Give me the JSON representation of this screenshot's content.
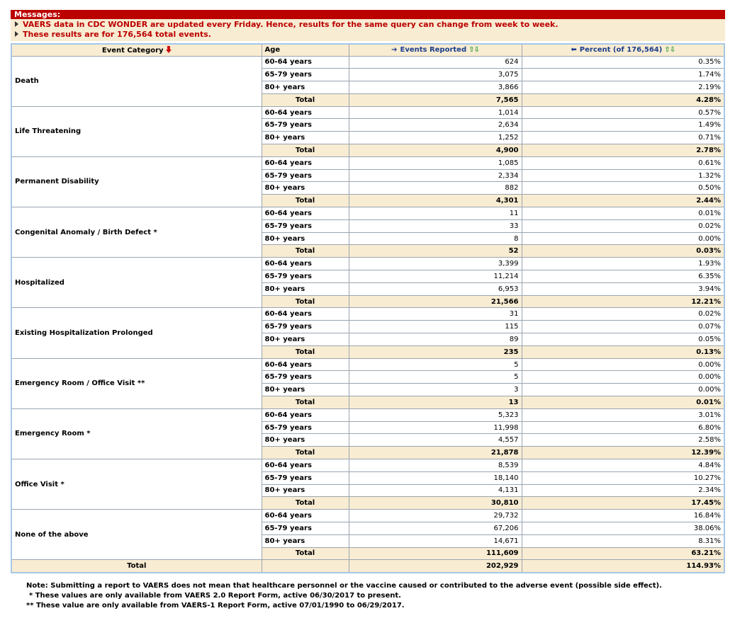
{
  "messages": {
    "header": "Messages:",
    "lines": [
      "VAERS data in CDC WONDER are updated every Friday. Hence, results for the same query can change from week to week.",
      "These results are for 176,564 total events."
    ]
  },
  "table": {
    "headers": {
      "event_category": "Event Category",
      "age": "Age",
      "events_reported": "Events Reported",
      "percent": "Percent (of 176,564)"
    },
    "total_label": "Total",
    "categories": [
      {
        "name": "Death",
        "rows": [
          {
            "age": "60-64 years",
            "events": "624",
            "percent": "0.35%"
          },
          {
            "age": "65-79 years",
            "events": "3,075",
            "percent": "1.74%"
          },
          {
            "age": "80+ years",
            "events": "3,866",
            "percent": "2.19%"
          }
        ],
        "total": {
          "events": "7,565",
          "percent": "4.28%"
        }
      },
      {
        "name": "Life Threatening",
        "rows": [
          {
            "age": "60-64 years",
            "events": "1,014",
            "percent": "0.57%"
          },
          {
            "age": "65-79 years",
            "events": "2,634",
            "percent": "1.49%"
          },
          {
            "age": "80+ years",
            "events": "1,252",
            "percent": "0.71%"
          }
        ],
        "total": {
          "events": "4,900",
          "percent": "2.78%"
        }
      },
      {
        "name": "Permanent Disability",
        "rows": [
          {
            "age": "60-64 years",
            "events": "1,085",
            "percent": "0.61%"
          },
          {
            "age": "65-79 years",
            "events": "2,334",
            "percent": "1.32%"
          },
          {
            "age": "80+ years",
            "events": "882",
            "percent": "0.50%"
          }
        ],
        "total": {
          "events": "4,301",
          "percent": "2.44%"
        }
      },
      {
        "name": "Congenital Anomaly / Birth Defect *",
        "rows": [
          {
            "age": "60-64 years",
            "events": "11",
            "percent": "0.01%"
          },
          {
            "age": "65-79 years",
            "events": "33",
            "percent": "0.02%"
          },
          {
            "age": "80+ years",
            "events": "8",
            "percent": "0.00%"
          }
        ],
        "total": {
          "events": "52",
          "percent": "0.03%"
        }
      },
      {
        "name": "Hospitalized",
        "rows": [
          {
            "age": "60-64 years",
            "events": "3,399",
            "percent": "1.93%"
          },
          {
            "age": "65-79 years",
            "events": "11,214",
            "percent": "6.35%"
          },
          {
            "age": "80+ years",
            "events": "6,953",
            "percent": "3.94%"
          }
        ],
        "total": {
          "events": "21,566",
          "percent": "12.21%"
        }
      },
      {
        "name": "Existing Hospitalization Prolonged",
        "rows": [
          {
            "age": "60-64 years",
            "events": "31",
            "percent": "0.02%"
          },
          {
            "age": "65-79 years",
            "events": "115",
            "percent": "0.07%"
          },
          {
            "age": "80+ years",
            "events": "89",
            "percent": "0.05%"
          }
        ],
        "total": {
          "events": "235",
          "percent": "0.13%"
        }
      },
      {
        "name": "Emergency Room / Office Visit **",
        "rows": [
          {
            "age": "60-64 years",
            "events": "5",
            "percent": "0.00%"
          },
          {
            "age": "65-79 years",
            "events": "5",
            "percent": "0.00%"
          },
          {
            "age": "80+ years",
            "events": "3",
            "percent": "0.00%"
          }
        ],
        "total": {
          "events": "13",
          "percent": "0.01%"
        }
      },
      {
        "name": "Emergency Room *",
        "rows": [
          {
            "age": "60-64 years",
            "events": "5,323",
            "percent": "3.01%"
          },
          {
            "age": "65-79 years",
            "events": "11,998",
            "percent": "6.80%"
          },
          {
            "age": "80+ years",
            "events": "4,557",
            "percent": "2.58%"
          }
        ],
        "total": {
          "events": "21,878",
          "percent": "12.39%"
        }
      },
      {
        "name": "Office Visit *",
        "rows": [
          {
            "age": "60-64 years",
            "events": "8,539",
            "percent": "4.84%"
          },
          {
            "age": "65-79 years",
            "events": "18,140",
            "percent": "10.27%"
          },
          {
            "age": "80+ years",
            "events": "4,131",
            "percent": "2.34%"
          }
        ],
        "total": {
          "events": "30,810",
          "percent": "17.45%"
        }
      },
      {
        "name": "None of the above",
        "rows": [
          {
            "age": "60-64 years",
            "events": "29,732",
            "percent": "16.84%"
          },
          {
            "age": "65-79 years",
            "events": "67,206",
            "percent": "38.06%"
          },
          {
            "age": "80+ years",
            "events": "14,671",
            "percent": "8.31%"
          }
        ],
        "total": {
          "events": "111,609",
          "percent": "63.21%"
        }
      }
    ],
    "grand_total": {
      "label": "Total",
      "events": "202,929",
      "percent": "114.93%"
    }
  },
  "notes": [
    "Note: Submitting a report to VAERS does not mean that healthcare personnel or the vaccine caused or contributed to the adverse event (possible side effect).",
    "* These values are only available from VAERS 2.0 Report Form, active 06/30/2017 to present.",
    "** These value are only available from VAERS-1 Report Form, active 07/01/1990 to 06/29/2017."
  ],
  "colors": {
    "message_header_bg": "#bb0000",
    "message_text": "#bb0000",
    "beige": "#f8ecd2",
    "table_border": "#a7c7e7",
    "link_blue": "#1a3c8c",
    "sort_green": "#2e9a2e",
    "sort_red": "#d01010"
  },
  "icons": {
    "message_bullet": "triangle-right-icon",
    "sort_desc": "red-down-arrow-icon",
    "move_right": "blue-right-arrow-icon",
    "move_left": "blue-left-arrow-icon",
    "sort_toggle": "green-up-down-arrows-icon"
  }
}
